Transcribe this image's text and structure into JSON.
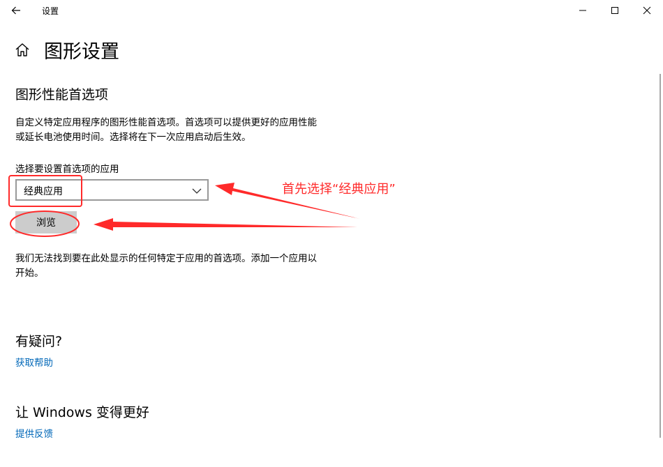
{
  "window": {
    "title": "设置",
    "back_icon": "arrow-left-icon",
    "controls": [
      "minimize-icon",
      "maximize-icon",
      "close-icon"
    ]
  },
  "header": {
    "home_icon": "home-icon",
    "title": "图形设置"
  },
  "graphics_preference": {
    "section_title": "图形性能首选项",
    "description": "自定义特定应用程序的图形性能首选项。首选项可以提供更好的应用性能或延长电池使用时间。选择将在下一次应用启动后生效。",
    "select_label": "选择要设置首选项的应用",
    "selected_app_type": "经典应用",
    "browse_label": "浏览",
    "empty_state": "我们无法找到要在此处显示的任何特定于应用的首选项。添加一个应用以开始。"
  },
  "help": {
    "heading": "有疑问?",
    "link": "获取帮助"
  },
  "improve": {
    "heading": "让 Windows 变得更好",
    "link": "提供反馈"
  },
  "annotation": {
    "text": "首先选择“经典应用”",
    "color": "#ff2a2a"
  },
  "colors": {
    "link": "#0067b8",
    "button_bg": "#cccccc",
    "select_border": "#999999"
  }
}
